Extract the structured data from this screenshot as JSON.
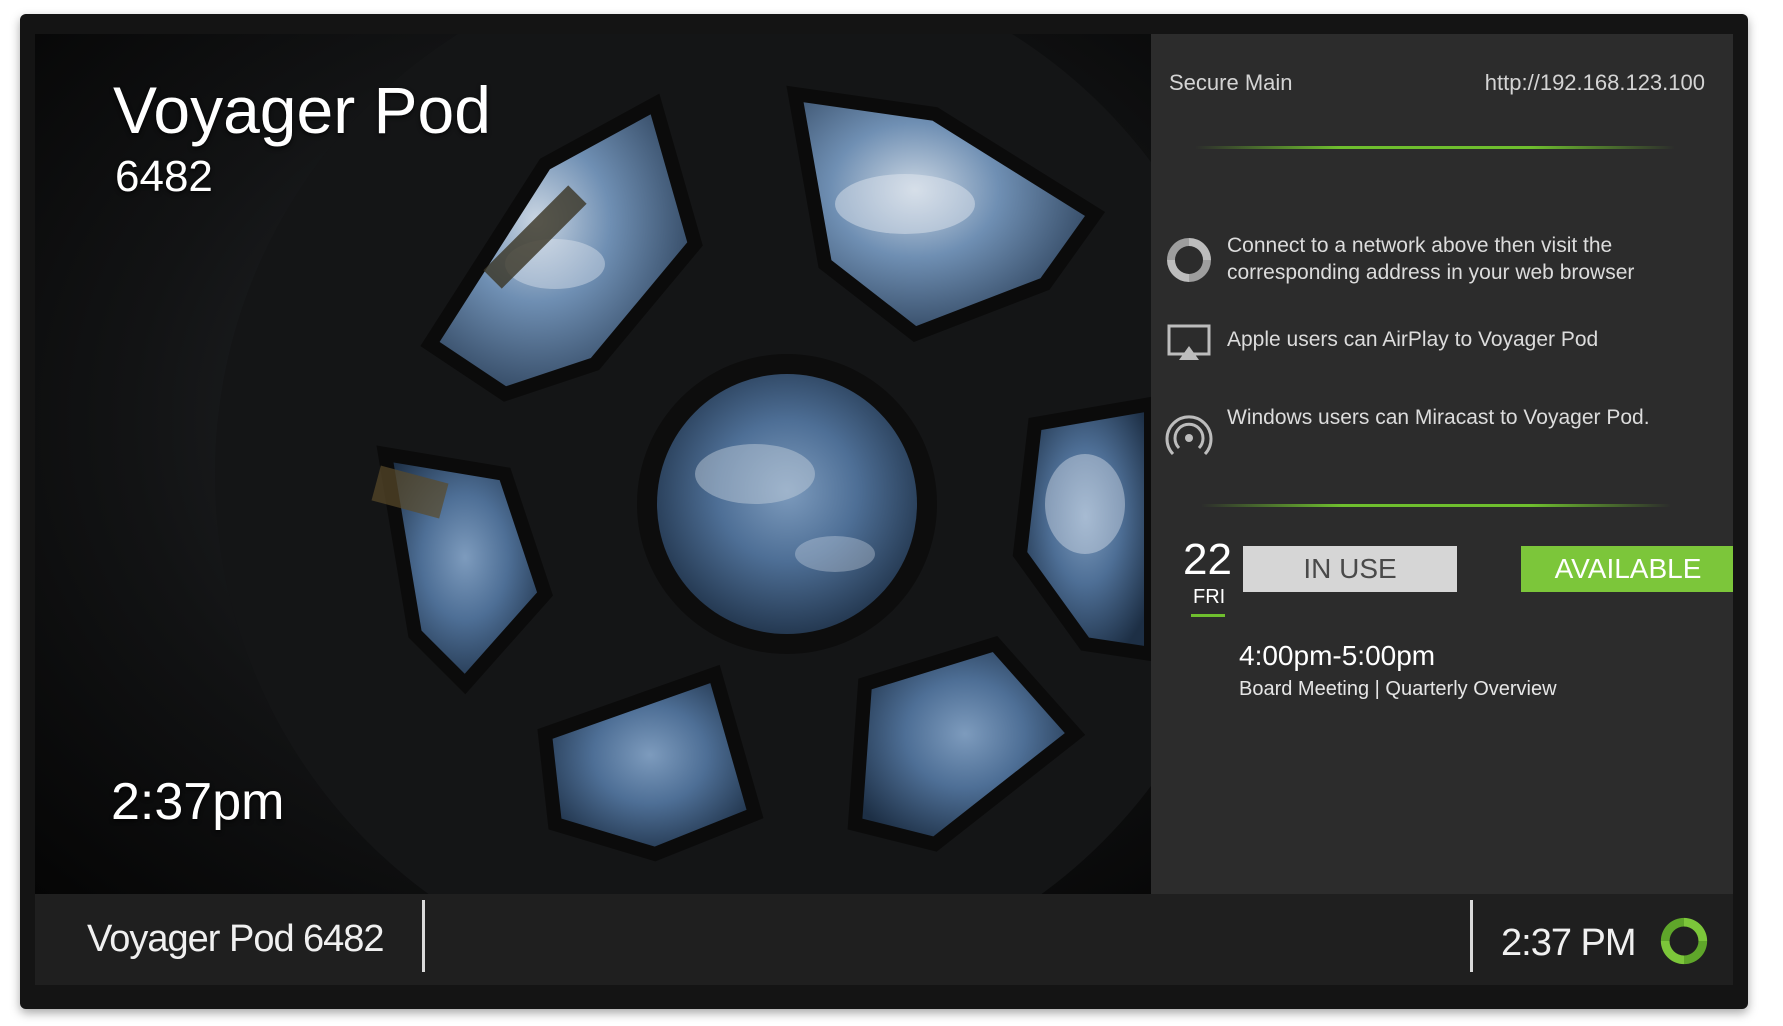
{
  "room": {
    "name": "Voyager Pod",
    "number": "6482",
    "clock": "2:37pm"
  },
  "network": {
    "name": "Secure Main",
    "url": "http://192.168.123.100"
  },
  "instructions": [
    {
      "icon": "refresh-logo-icon",
      "text": "Connect to a network above then visit the corresponding address in your web browser"
    },
    {
      "icon": "airplay-icon",
      "text": "Apple users can AirPlay to Voyager Pod"
    },
    {
      "icon": "miracast-icon",
      "text": "Windows users can Miracast to Voyager Pod."
    }
  ],
  "schedule": {
    "date_number": "22",
    "day": "FRI",
    "in_use_label": "IN USE",
    "available_label": "AVAILABLE",
    "event_time": "4:00pm-5:00pm",
    "event_title": "Board Meeting | Quarterly Overview"
  },
  "status_bar": {
    "name": "Voyager Pod",
    "number": "6482",
    "time": "2:37 PM"
  },
  "colors": {
    "accent_green": "#7cc63a",
    "panel_bg": "#2c2c2c",
    "in_use_bg": "#d6d6d6"
  }
}
